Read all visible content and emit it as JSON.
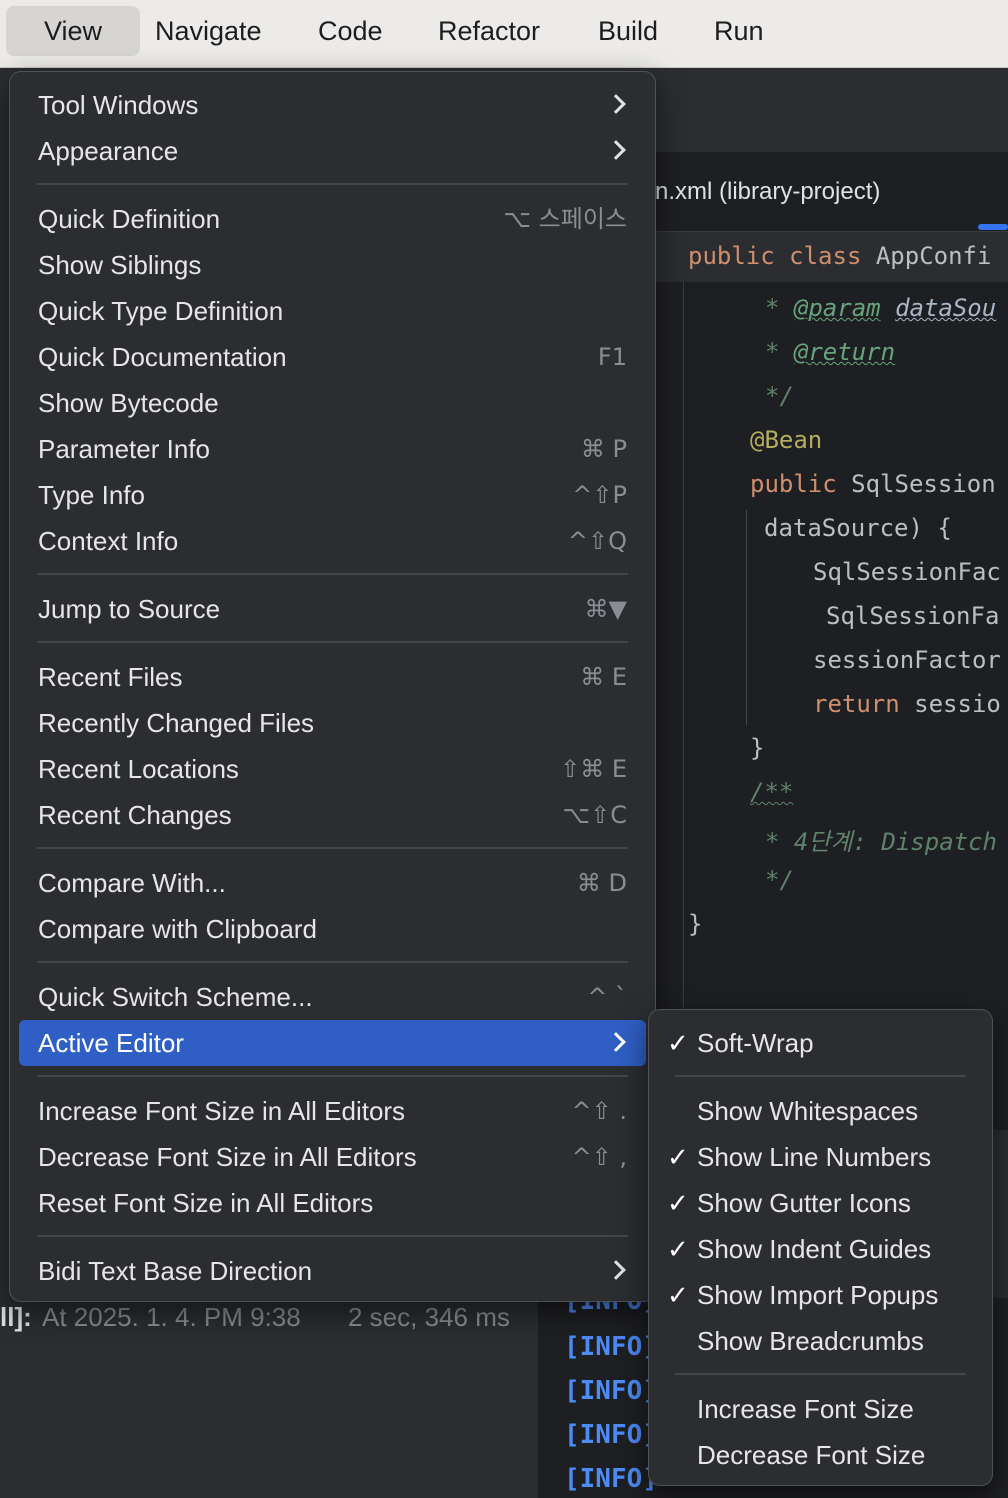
{
  "menubar": {
    "items": [
      "View",
      "Navigate",
      "Code",
      "Refactor",
      "Build",
      "Run"
    ]
  },
  "editor": {
    "tab_label": "n.xml (library-project)",
    "sticky_kw1": "public",
    "sticky_kw2": "class",
    "sticky_name": "AppConfi",
    "lines": {
      "l1_star": "* ",
      "l1_tag": "@param",
      "l1_param": "dataSou",
      "l2_star": "* ",
      "l2_tag": "@return",
      "l3": "*/",
      "l4": "@Bean",
      "l5_kw": "public",
      "l5_rest": " SqlSession",
      "l6": "dataSource) {",
      "l7": "SqlSessionFac",
      "l8": "SqlSessionFa",
      "l9": "sessionFactor",
      "l10_kw": "return",
      "l10_rest": " sessio",
      "l11": "}",
      "l12": "/**",
      "l13": "* 4단계: Dispatch",
      "l14": "*/",
      "l15": "}"
    }
  },
  "build": {
    "prefix": "ll]:",
    "time": "At 2025. 1. 4. PM 9:38",
    "duration": "2 sec, 346 ms"
  },
  "console": {
    "lines": [
      "[INFO]",
      "[INFO]",
      "[INFO]",
      "[INFO]",
      "[INFO]"
    ]
  },
  "main_menu": {
    "tool_windows": "Tool Windows",
    "appearance": "Appearance",
    "quick_definition": "Quick Definition",
    "quick_definition_sc": "⌥ 스페이스",
    "show_siblings": "Show Siblings",
    "quick_type_definition": "Quick Type Definition",
    "quick_documentation": "Quick Documentation",
    "quick_documentation_sc": "F1",
    "show_bytecode": "Show Bytecode",
    "parameter_info": "Parameter Info",
    "parameter_info_sc": "⌘ P",
    "type_info": "Type Info",
    "type_info_sc": "^⇧P",
    "context_info": "Context Info",
    "context_info_sc": "^⇧Q",
    "jump_to_source": "Jump to Source",
    "jump_to_source_sc": "⌘▼",
    "recent_files": "Recent Files",
    "recent_files_sc": "⌘ E",
    "recently_changed_files": "Recently Changed Files",
    "recent_locations": "Recent Locations",
    "recent_locations_sc": "⇧⌘ E",
    "recent_changes": "Recent Changes",
    "recent_changes_sc": "⌥⇧C",
    "compare_with": "Compare With...",
    "compare_with_sc": "⌘ D",
    "compare_with_clipboard": "Compare with Clipboard",
    "quick_switch_scheme": "Quick Switch Scheme...",
    "quick_switch_scheme_sc": "^ `",
    "active_editor": "Active Editor",
    "increase_font_all": "Increase Font Size in All Editors",
    "increase_font_all_sc": "^⇧ .",
    "decrease_font_all": "Decrease Font Size in All Editors",
    "decrease_font_all_sc": "^⇧ ,",
    "reset_font_all": "Reset Font Size in All Editors",
    "bidi": "Bidi Text Base Direction"
  },
  "sub_menu": {
    "check_mark": "✓",
    "soft_wrap": "Soft-Wrap",
    "show_whitespaces": "Show Whitespaces",
    "show_line_numbers": "Show Line Numbers",
    "show_gutter_icons": "Show Gutter Icons",
    "show_indent_guides": "Show Indent Guides",
    "show_import_popups": "Show Import Popups",
    "show_breadcrumbs": "Show Breadcrumbs",
    "increase_font_size": "Increase Font Size",
    "decrease_font_size": "Decrease Font Size"
  },
  "colors": {
    "selection": "#2f5fc4",
    "menu_bg": "#2b2d30",
    "keyword": "#cf8e6d",
    "annotation": "#b3ae60",
    "doc_comment": "#5f826b",
    "console_info": "#4d8bf5"
  }
}
